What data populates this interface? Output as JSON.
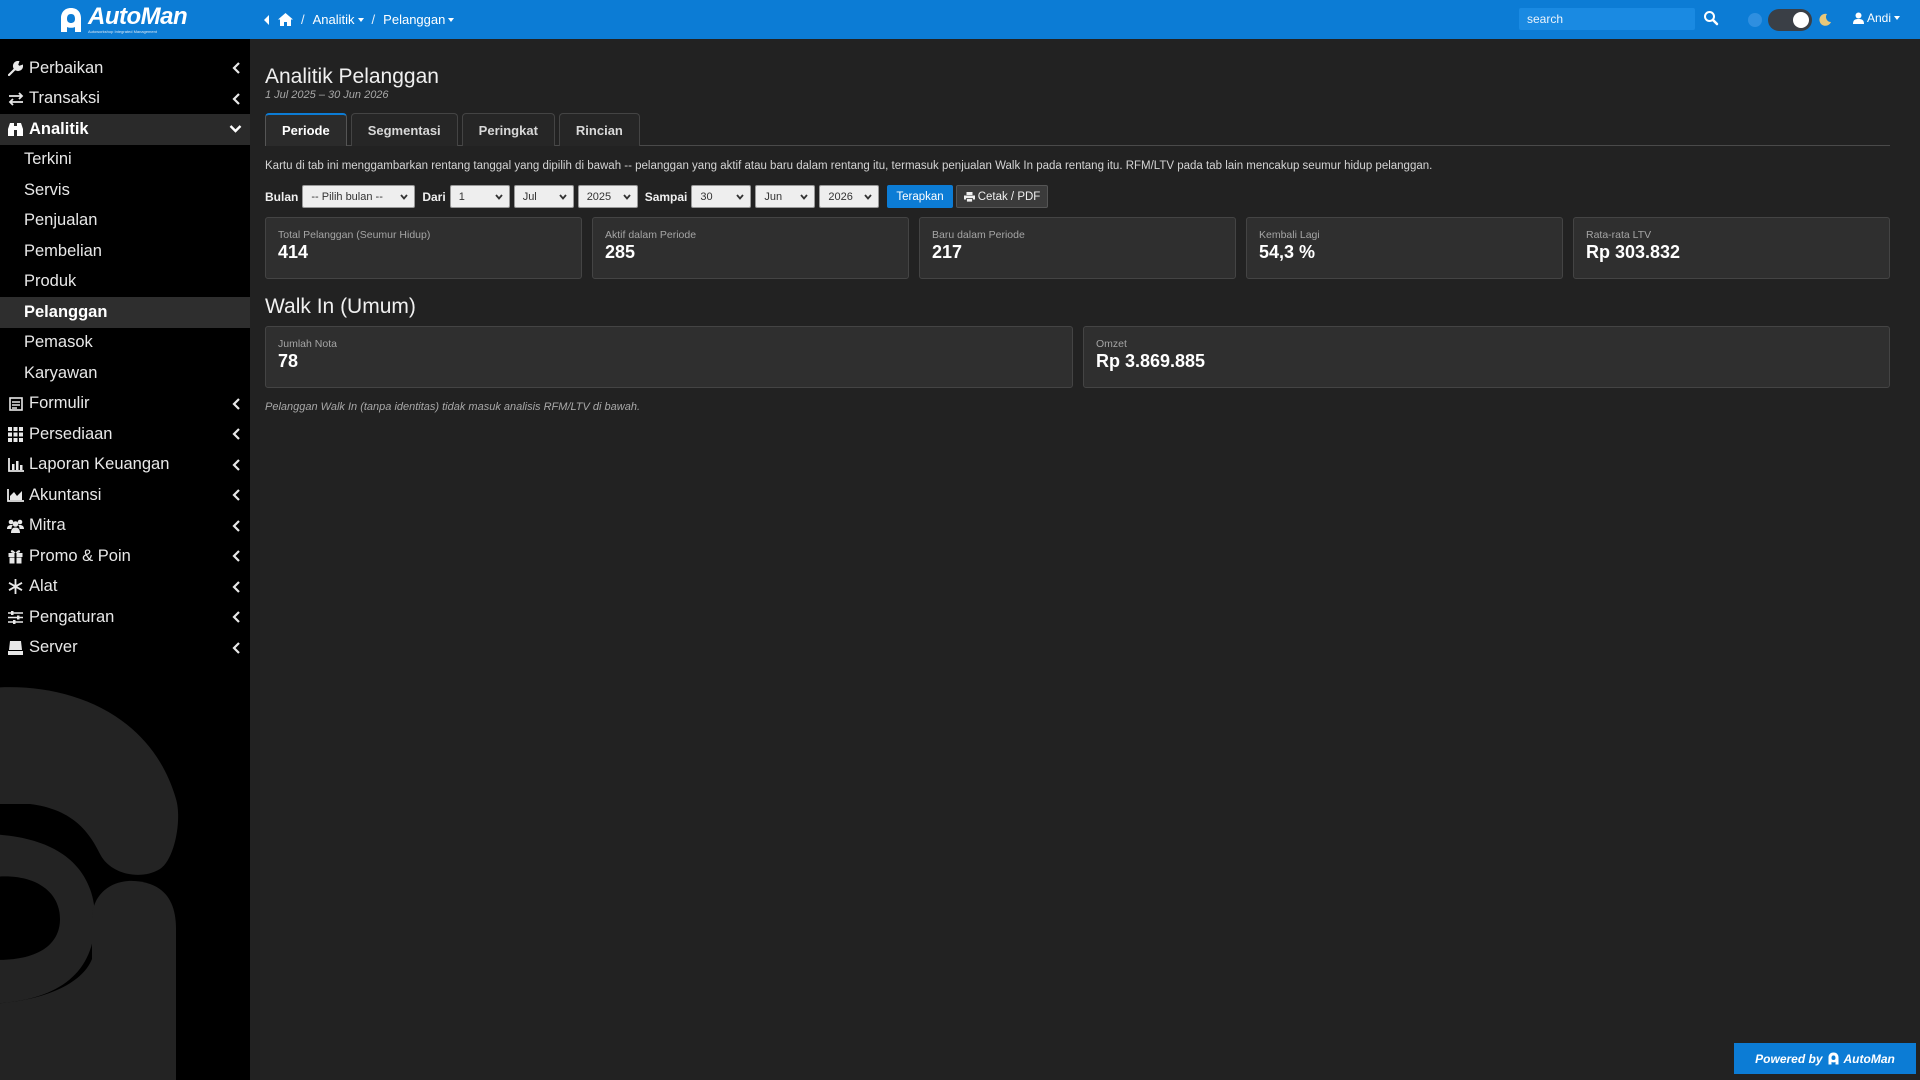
{
  "brand": {
    "name": "AutoMan",
    "tagline": "Autoworkshop Integrated Management"
  },
  "breadcrumb": {
    "items": [
      "Analitik",
      "Pelanggan"
    ],
    "separator": "/"
  },
  "search": {
    "placeholder": "search"
  },
  "user": {
    "name": "Andi"
  },
  "theme": {
    "mode": "dark"
  },
  "sidebar": {
    "items": [
      {
        "label": "Perbaikan",
        "icon": "wrench-icon"
      },
      {
        "label": "Transaksi",
        "icon": "exchange-icon"
      },
      {
        "label": "Analitik",
        "icon": "binoculars-icon",
        "open": true
      },
      {
        "label": "Formulir",
        "icon": "form-icon"
      },
      {
        "label": "Persediaan",
        "icon": "grid-icon"
      },
      {
        "label": "Laporan Keuangan",
        "icon": "bar-chart-icon"
      },
      {
        "label": "Akuntansi",
        "icon": "area-chart-icon"
      },
      {
        "label": "Mitra",
        "icon": "users-icon"
      },
      {
        "label": "Promo & Poin",
        "icon": "gift-icon"
      },
      {
        "label": "Alat",
        "icon": "snowflake-icon"
      },
      {
        "label": "Pengaturan",
        "icon": "sliders-icon"
      },
      {
        "label": "Server",
        "icon": "server-icon"
      }
    ],
    "analitik_sub": [
      "Terkini",
      "Servis",
      "Penjualan",
      "Pembelian",
      "Produk",
      "Pelanggan",
      "Pemasok",
      "Karyawan"
    ],
    "active_sub": "Pelanggan"
  },
  "page": {
    "title": "Analitik Pelanggan",
    "date_range": "1 Jul 2025 – 30 Jun 2026",
    "tabs": [
      "Periode",
      "Segmentasi",
      "Peringkat",
      "Rincian"
    ],
    "active_tab": "Periode",
    "note": "Kartu di tab ini menggambarkan rentang tanggal yang dipilih di bawah -- pelanggan yang aktif atau baru dalam rentang itu, termasuk penjualan Walk In pada rentang itu. RFM/LTV pada tab lain mencakup seumur hidup pelanggan."
  },
  "filters": {
    "bulan_label": "Bulan",
    "bulan_value": "-- Pilih bulan --",
    "dari_label": "Dari",
    "dari_day": "1",
    "dari_month": "Jul",
    "dari_year": "2025",
    "sampai_label": "Sampai",
    "sampai_day": "30",
    "sampai_month": "Jun",
    "sampai_year": "2026",
    "apply_label": "Terapkan",
    "print_label": "Cetak / PDF"
  },
  "stats": [
    {
      "label": "Total Pelanggan (Seumur Hidup)",
      "value": "414"
    },
    {
      "label": "Aktif dalam Periode",
      "value": "285"
    },
    {
      "label": "Baru dalam Periode",
      "value": "217"
    },
    {
      "label": "Kembali Lagi",
      "value": "54,3 %"
    },
    {
      "label": "Rata-rata LTV",
      "value": "Rp 303.832"
    }
  ],
  "walkin": {
    "title": "Walk In (Umum)",
    "cards": [
      {
        "label": "Jumlah Nota",
        "value": "78"
      },
      {
        "label": "Omzet",
        "value": "Rp 3.869.885"
      }
    ],
    "footnote": "Pelanggan Walk In (tanpa identitas) tidak masuk analisis RFM/LTV di bawah."
  },
  "footer": {
    "powered_label": "Powered by",
    "brand": "AutoMan"
  },
  "colors": {
    "accent": "#0c7cd5",
    "sidebar": "#000000",
    "content": "#222222",
    "card": "#2f2f2f"
  }
}
